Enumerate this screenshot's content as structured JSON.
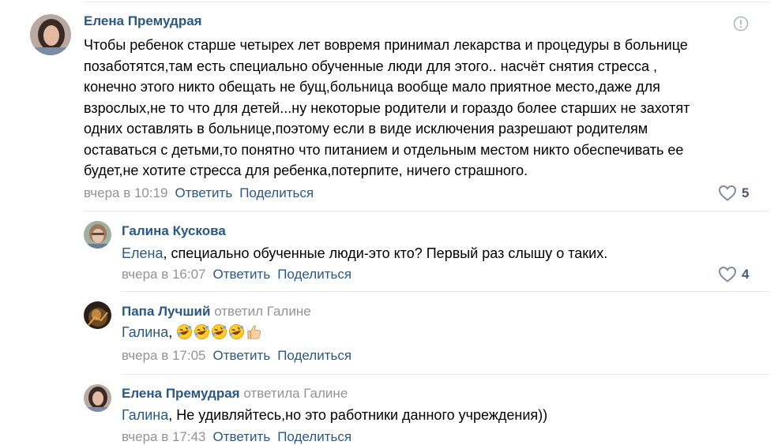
{
  "comments": [
    {
      "author": "Елена Премудрая",
      "lines": [
        "Чтобы ребенок старше четырех лет вовремя принимал лекарства и процедуры в больнице",
        "позаботятся,там есть специально обученные люди для этого.. насчёт снятия стресса ,",
        "конечно этого никто обещать не бущ,больница вообще мало приятное место,даже для",
        "взрослых,не то что для детей...ну некоторые родители и гораздо более старших не захотят",
        "одних оставлять в больнице,поэтому если в виде исключения разрешают родителям",
        "оставаться с детьми,то понятно что питанием и отдельным местом никто обеспечивать ее",
        "будет,не хотите стресса для ребенка,потерпите, ничего страшного."
      ],
      "time": "вчера в 10:19",
      "reply_label": "Ответить",
      "share_label": "Поделиться",
      "likes": "5"
    },
    {
      "author": "Галина Кускова",
      "mention": "Елена",
      "text": ", специально обученные люди-это кто? Первый раз слышу о таких.",
      "time": "вчера в 16:07",
      "reply_label": "Ответить",
      "share_label": "Поделиться",
      "likes": "4"
    },
    {
      "author": "Папа Лучший",
      "replied_to": "ответил Галине",
      "mention": "Галина",
      "text": ",",
      "emojis": [
        "rofl-emoji",
        "rofl-emoji",
        "rofl-emoji",
        "rofl-emoji",
        "thumbs-up-emoji"
      ],
      "time": "вчера в 17:05",
      "reply_label": "Ответить",
      "share_label": "Поделиться"
    },
    {
      "author": "Елена Премудрая",
      "replied_to": "ответила Галине",
      "mention": "Галина",
      "text": ", Не удивляйтесь,но это работники данного учреждения))",
      "time": "вчера в 17:43",
      "reply_label": "Ответить",
      "share_label": "Поделиться"
    }
  ],
  "colors": {
    "link": "#2a5885",
    "muted": "#939393",
    "divider": "#e7e8ec"
  },
  "icons": {
    "report": "report-icon",
    "like": "heart-icon"
  }
}
